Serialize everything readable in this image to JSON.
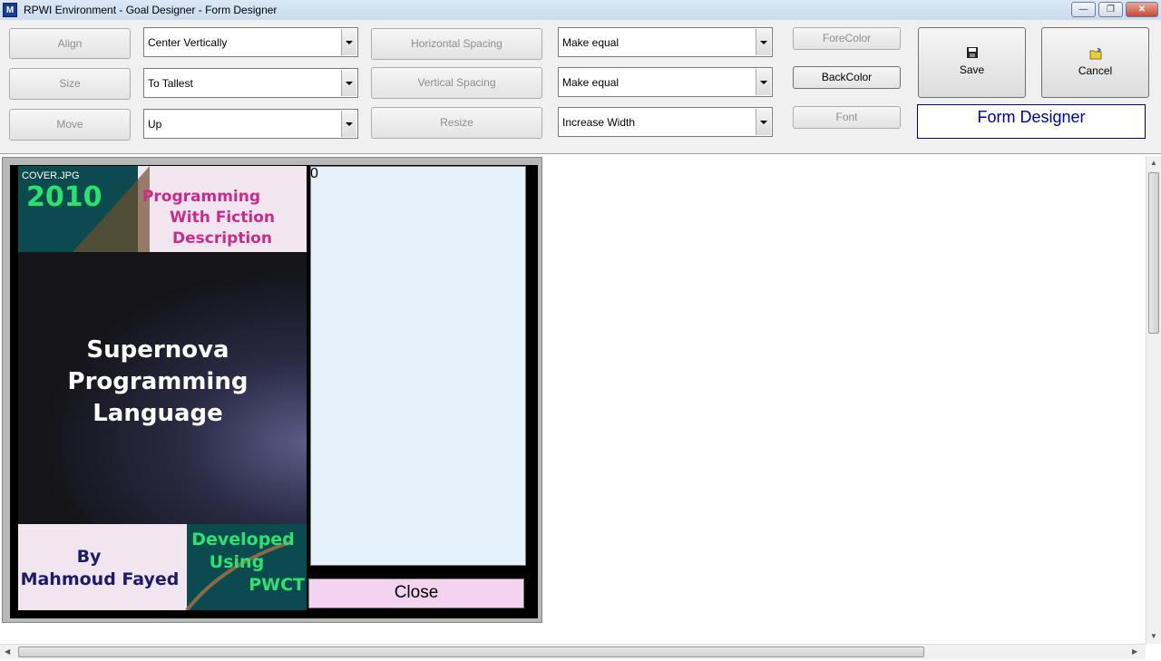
{
  "window": {
    "title": "RPWI Environment - Goal Designer - Form Designer",
    "app_icon": "M",
    "controls": {
      "minimize": "—",
      "restore": "❐",
      "close": "✕"
    }
  },
  "toolbar": {
    "align_label": "Align",
    "size_label": "Size",
    "move_label": "Move",
    "align_value": "Center Vertically",
    "size_value": "To Tallest",
    "move_value": "Up",
    "hspacing_label": "Horizontal Spacing",
    "vspacing_label": "Vertical Spacing",
    "resize_label": "Resize",
    "hspacing_value": "Make equal",
    "vspacing_value": "Make equal",
    "resize_value": "Increase Width",
    "forecolor_label": "ForeColor",
    "backcolor_label": "BackColor",
    "font_label": "Font",
    "save_label": "Save",
    "cancel_label": "Cancel",
    "form_name": "Form Designer"
  },
  "form": {
    "cover": {
      "filename": "COVER.JPG",
      "year": "2010",
      "top_line1": "Programming",
      "top_line2": "With Fiction",
      "top_line3": "Description",
      "title_line1": "Supernova",
      "title_line2": "Programming",
      "title_line3": "Language",
      "by_label": "By",
      "author": "Mahmoud Fayed",
      "dev_line1": "Developed",
      "dev_line2": "Using",
      "dev_line3": "PWCT"
    },
    "memo_value": "0",
    "close_label": "Close"
  },
  "colors": {
    "year": "#29e36f",
    "pink_title": "#cc2a8a",
    "green_text": "#2de36f",
    "author": "#1b1b6a",
    "memo_bg": "#e6f2fb",
    "close_bg": "#f3d3ef"
  }
}
